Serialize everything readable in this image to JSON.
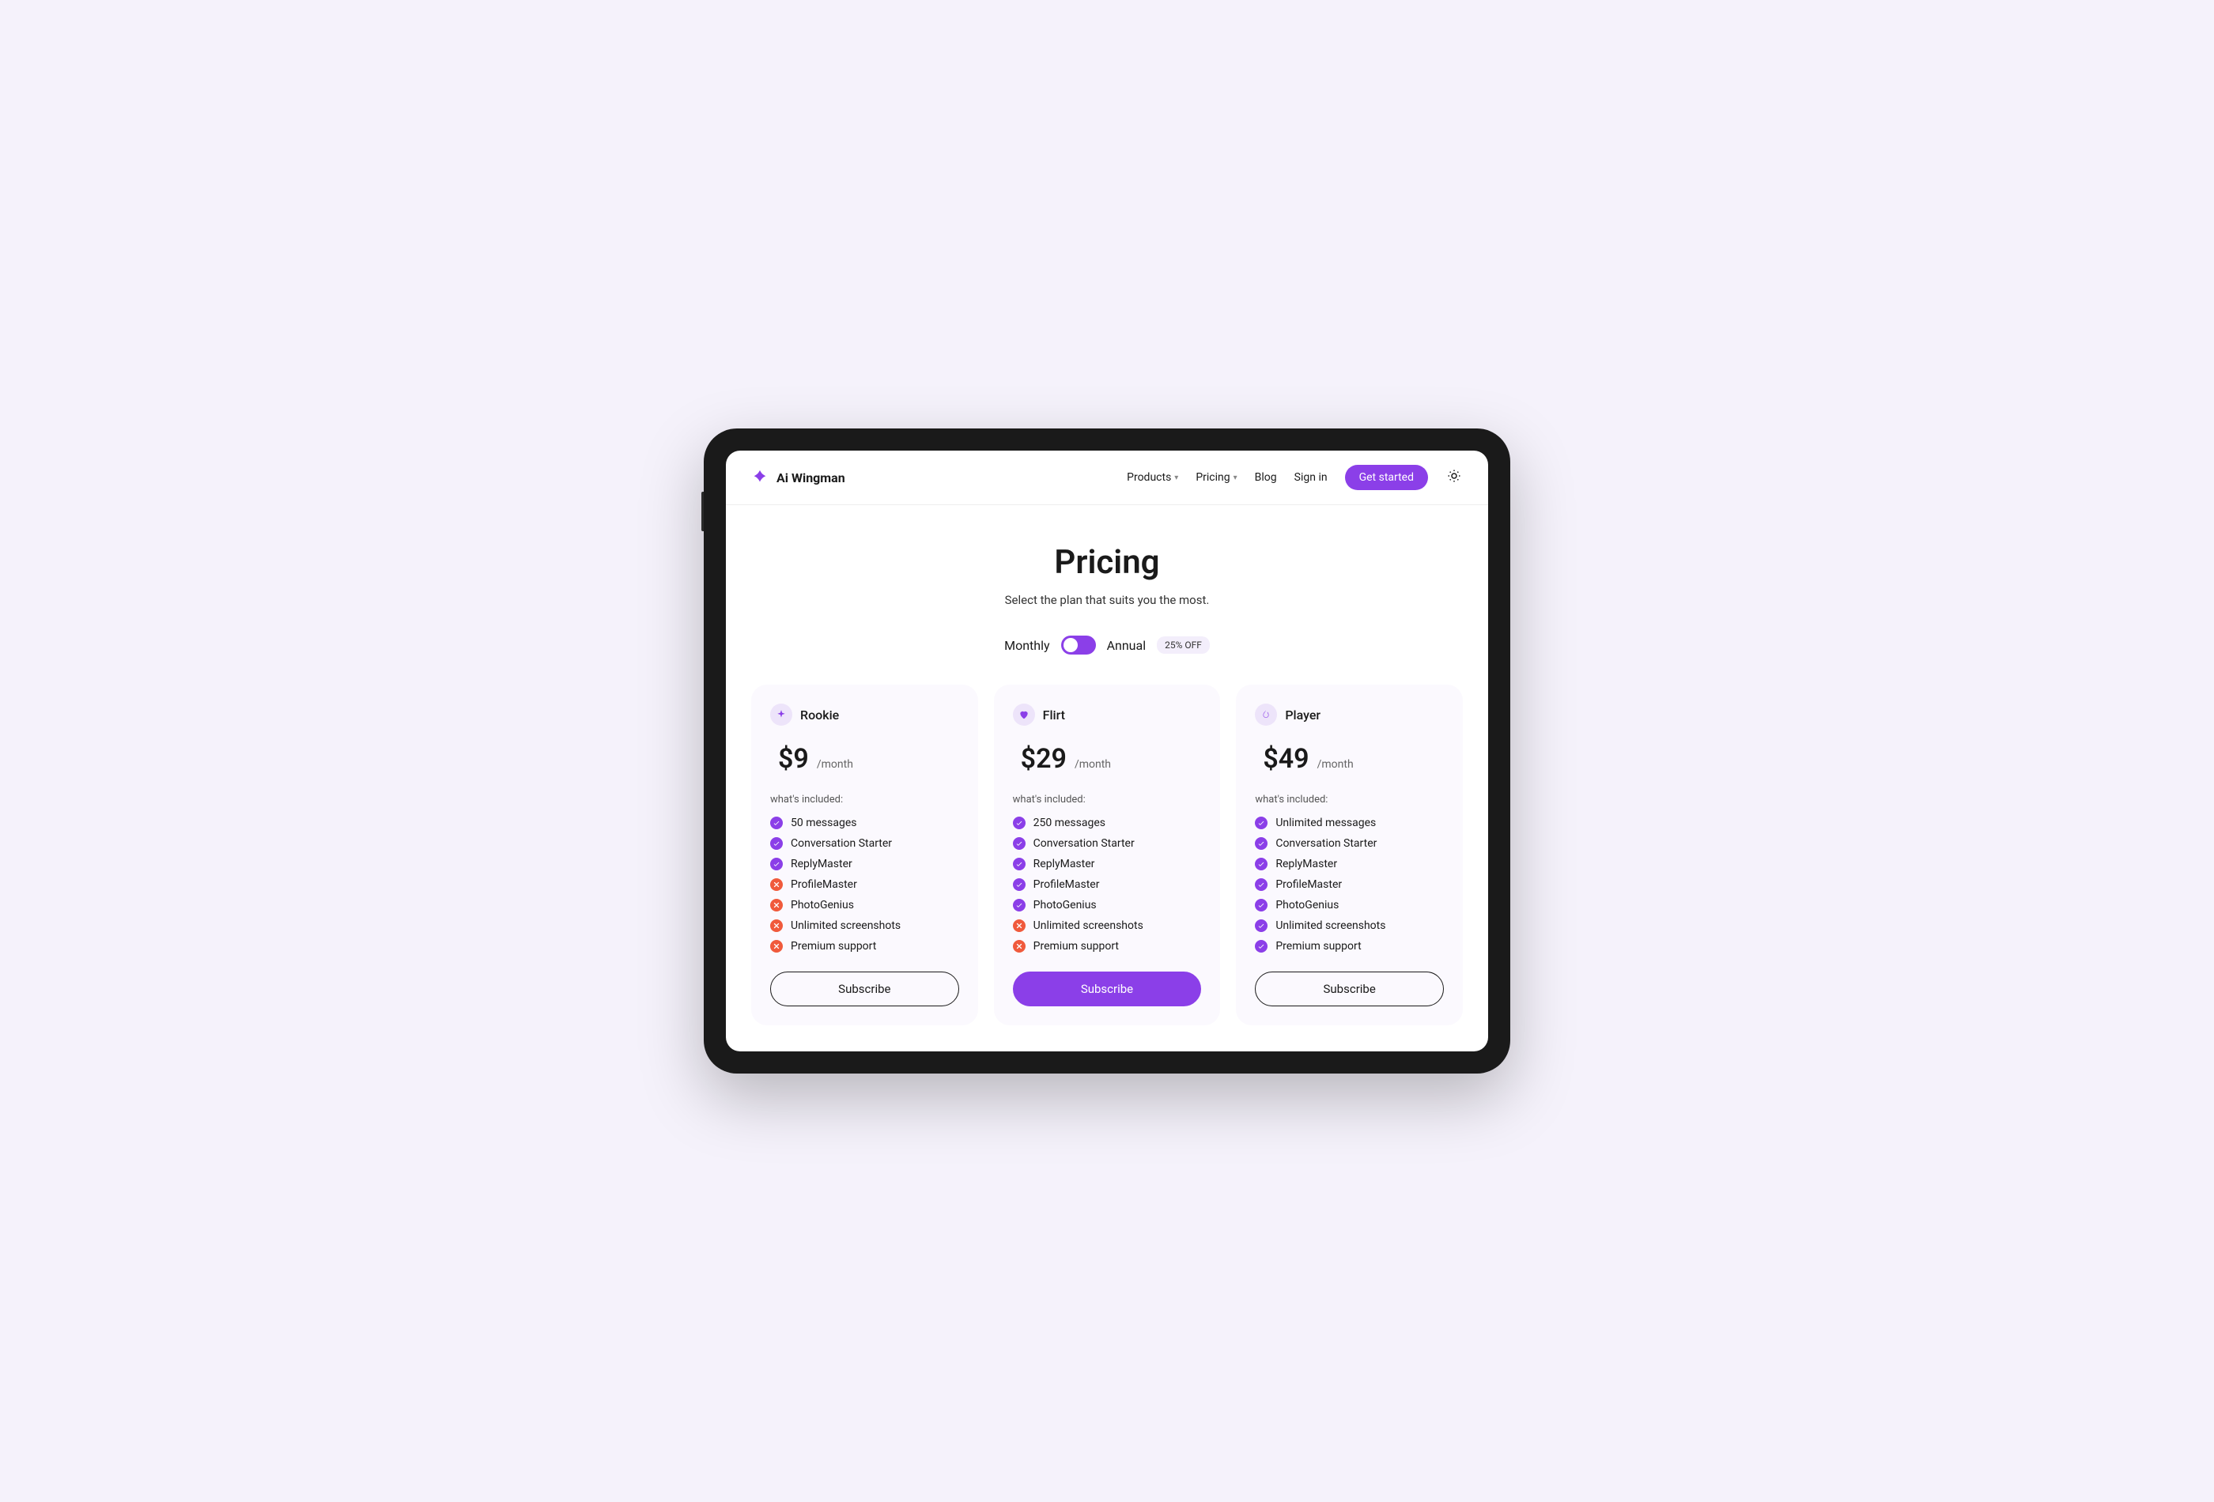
{
  "header": {
    "brand": "Ai Wingman",
    "nav": {
      "products": "Products",
      "pricing": "Pricing",
      "blog": "Blog",
      "signin": "Sign in",
      "getstarted": "Get started"
    }
  },
  "page": {
    "title": "Pricing",
    "subtitle": "Select the plan that suits you the most."
  },
  "toggle": {
    "monthly": "Monthly",
    "annual": "Annual",
    "discount": "25% OFF"
  },
  "included_label": "what's included:",
  "subscribe_label": "Subscribe",
  "plans": [
    {
      "name": "Rookie",
      "price": "$9",
      "period": "/month",
      "features": [
        {
          "label": "50 messages",
          "on": true
        },
        {
          "label": "Conversation Starter",
          "on": true
        },
        {
          "label": "ReplyMaster",
          "on": true
        },
        {
          "label": "ProfileMaster",
          "on": false
        },
        {
          "label": "PhotoGenius",
          "on": false
        },
        {
          "label": "Unlimited screenshots",
          "on": false
        },
        {
          "label": "Premium support",
          "on": false
        }
      ]
    },
    {
      "name": "Flirt",
      "price": "$29",
      "period": "/month",
      "features": [
        {
          "label": "250 messages",
          "on": true
        },
        {
          "label": "Conversation Starter",
          "on": true
        },
        {
          "label": "ReplyMaster",
          "on": true
        },
        {
          "label": "ProfileMaster",
          "on": true
        },
        {
          "label": "PhotoGenius",
          "on": true
        },
        {
          "label": "Unlimited screenshots",
          "on": false
        },
        {
          "label": "Premium support",
          "on": false
        }
      ]
    },
    {
      "name": "Player",
      "price": "$49",
      "period": "/month",
      "features": [
        {
          "label": "Unlimited messages",
          "on": true
        },
        {
          "label": "Conversation Starter",
          "on": true
        },
        {
          "label": "ReplyMaster",
          "on": true
        },
        {
          "label": "ProfileMaster",
          "on": true
        },
        {
          "label": "PhotoGenius",
          "on": true
        },
        {
          "label": "Unlimited screenshots",
          "on": true
        },
        {
          "label": "Premium support",
          "on": true
        }
      ]
    }
  ]
}
